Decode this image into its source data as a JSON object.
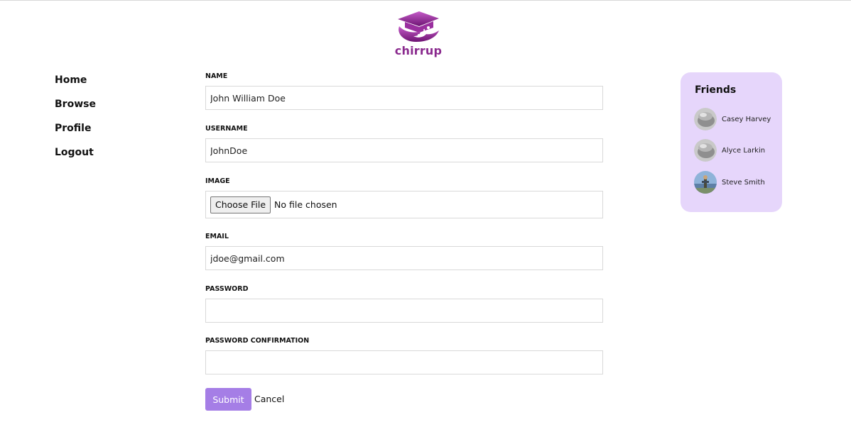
{
  "brand": {
    "name": "chirrup",
    "color": "#8a2a8e"
  },
  "nav": {
    "items": [
      {
        "label": "Home"
      },
      {
        "label": "Browse"
      },
      {
        "label": "Profile"
      },
      {
        "label": "Logout"
      }
    ]
  },
  "form": {
    "name": {
      "label": "NAME",
      "value": "John William Doe"
    },
    "username": {
      "label": "USERNAME",
      "value": "JohnDoe"
    },
    "image": {
      "label": "IMAGE",
      "button_label": "Choose File",
      "status": "No file chosen"
    },
    "email": {
      "label": "EMAIL",
      "value": "jdoe@gmail.com"
    },
    "password": {
      "label": "PASSWORD",
      "value": ""
    },
    "password_confirmation": {
      "label": "PASSWORD CONFIRMATION",
      "value": ""
    },
    "submit_label": "Submit",
    "cancel_label": "Cancel",
    "submit_color": "#a57ee6"
  },
  "friends": {
    "title": "Friends",
    "panel_color": "#e6d6fb",
    "items": [
      {
        "name": "Casey Harvey",
        "avatar": "default-avatar-icon"
      },
      {
        "name": "Alyce Larkin",
        "avatar": "default-avatar-icon"
      },
      {
        "name": "Steve Smith",
        "avatar": "photo-avatar"
      }
    ]
  }
}
